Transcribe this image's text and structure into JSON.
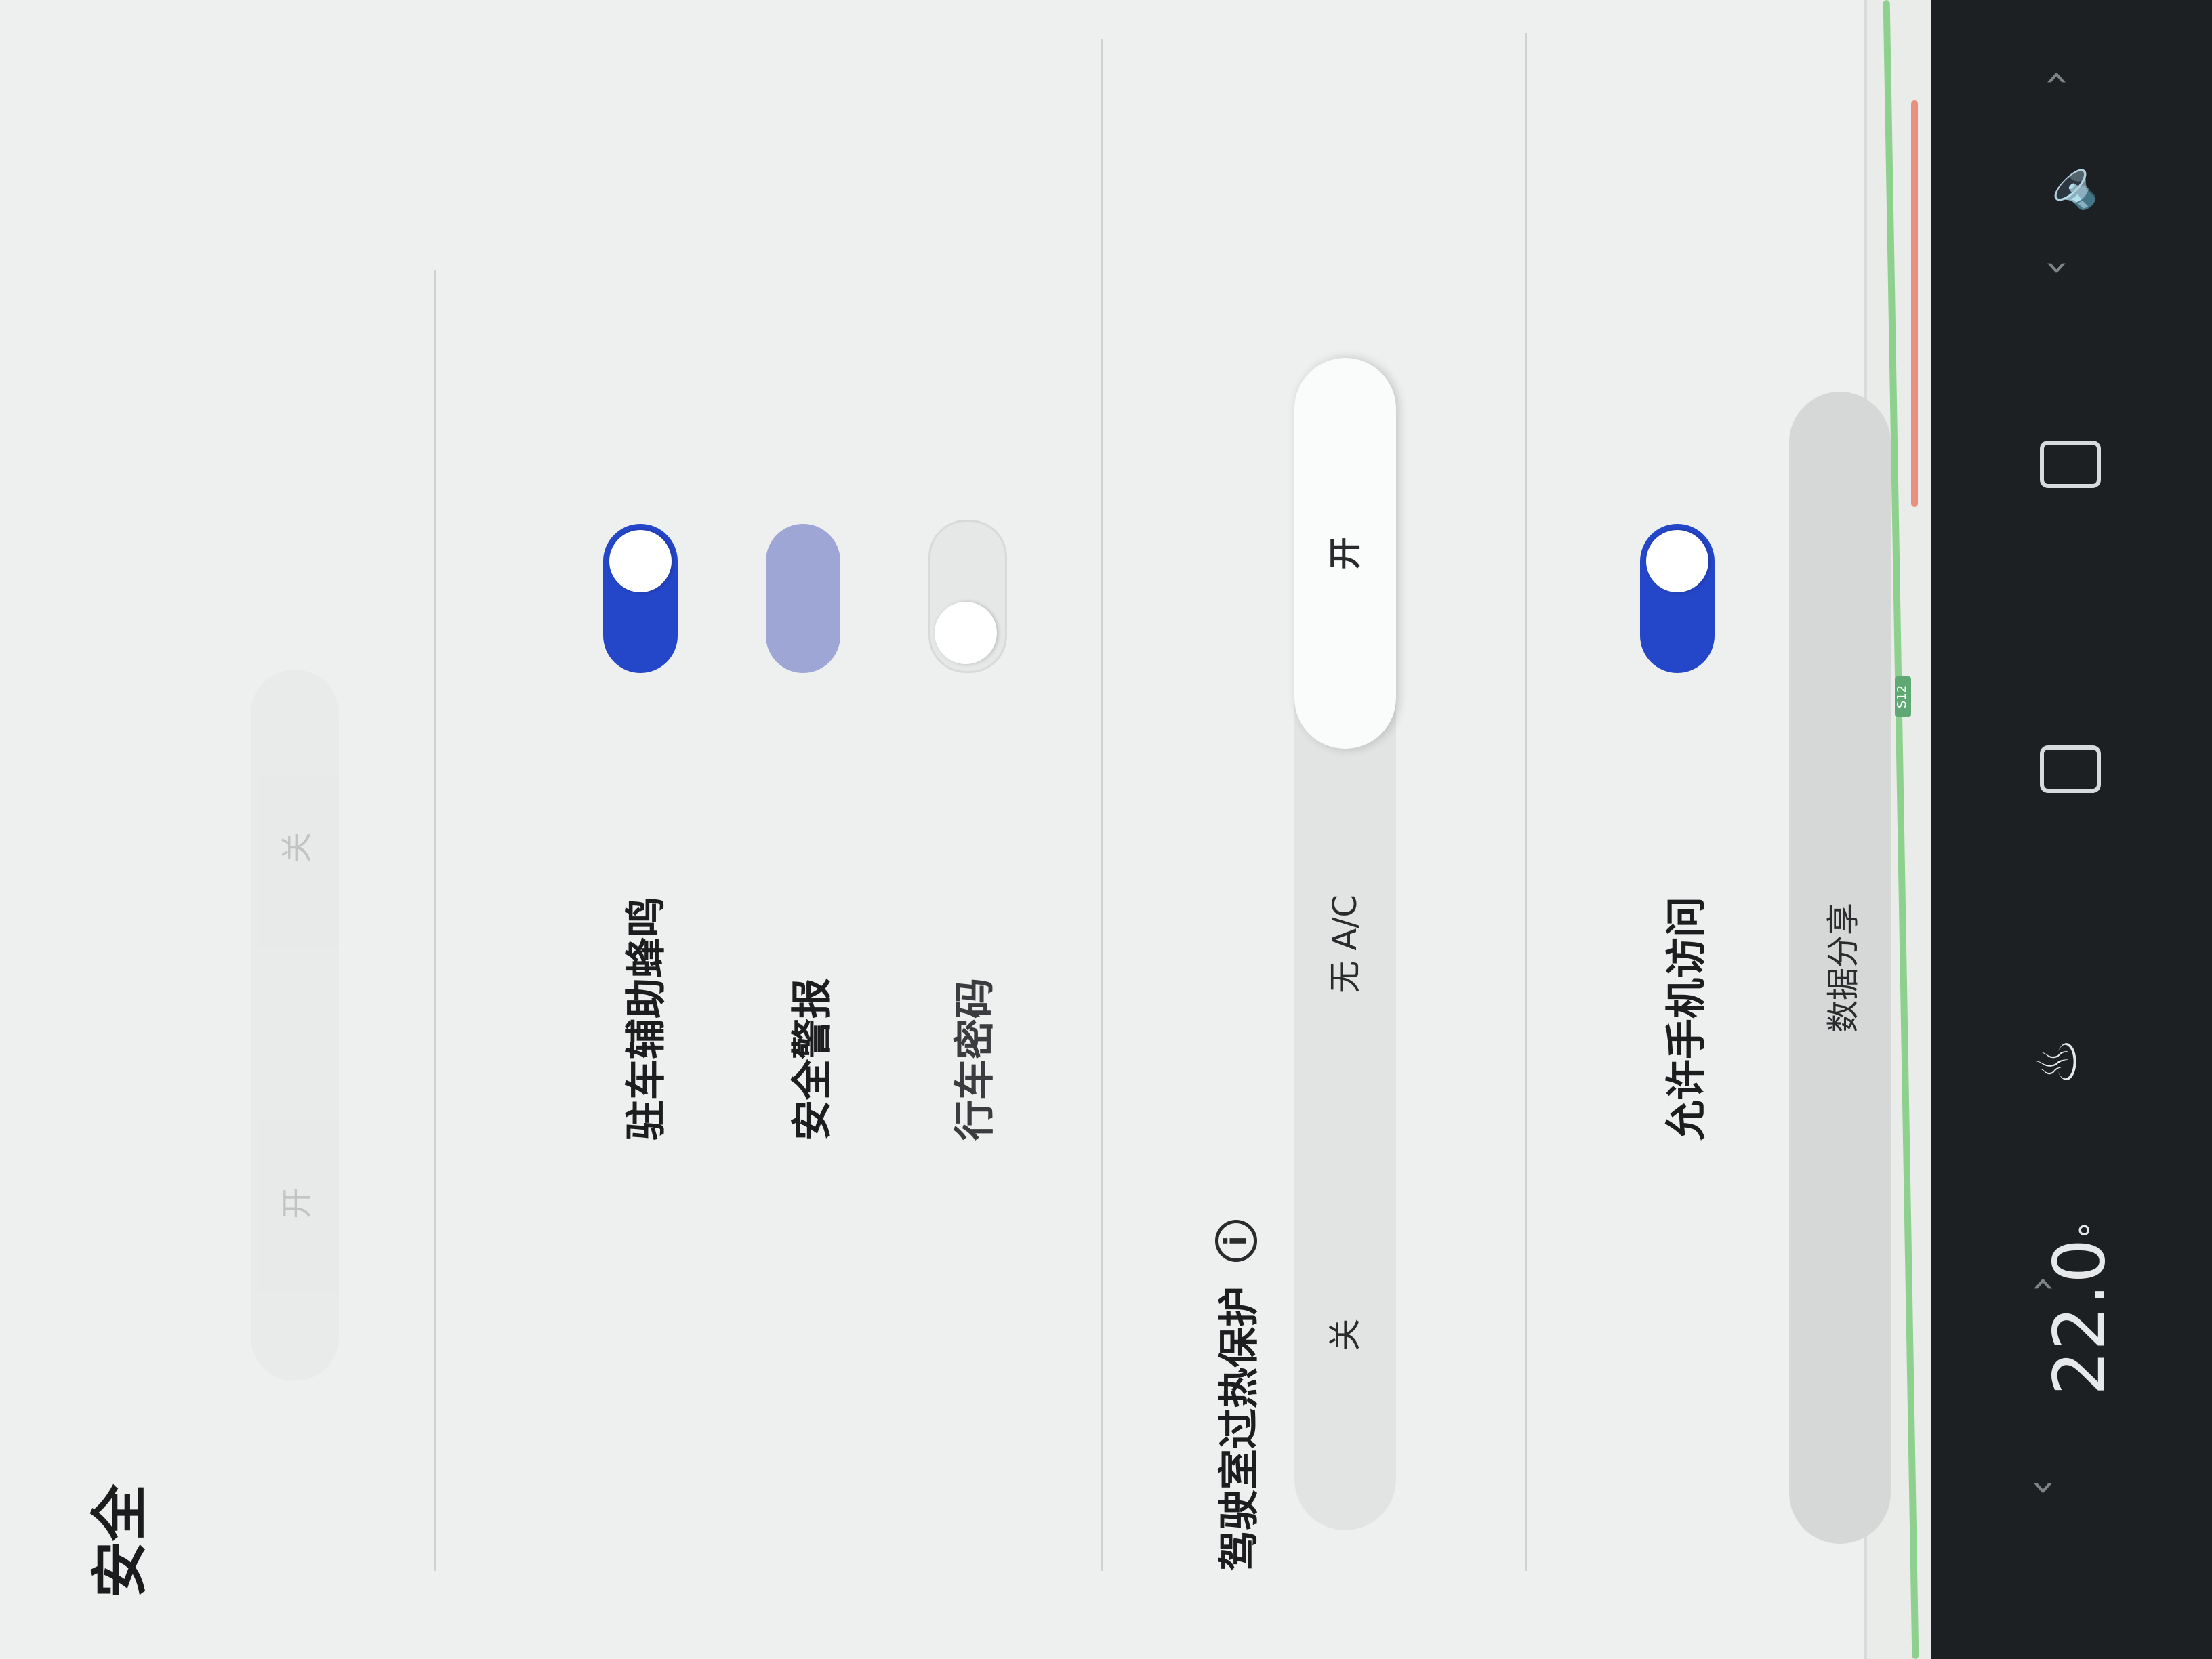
{
  "settings": {
    "title": "安全",
    "top_segment": {
      "options": [
        "开",
        "关"
      ]
    },
    "toggles": [
      {
        "label": "驻车辅助蜂鸣",
        "state": "on"
      },
      {
        "label": "安全警报",
        "state": "disabled"
      },
      {
        "label": "行车密码",
        "state": "off"
      }
    ],
    "overheat": {
      "label": "驾驶室过热保护",
      "info_icon": "i",
      "options": [
        "关",
        "无 A/C",
        "开"
      ],
      "selected": "开"
    },
    "phone_access": {
      "label": "允许手机访问",
      "state": "on"
    },
    "share_button": "数据分享"
  },
  "control_bar": {
    "temperature": "22.0",
    "temp_unit": "°",
    "left_chevron": "‹",
    "right_chevron": "›",
    "icons": [
      "seat-heat-icon",
      "rear-defrost-icon",
      "front-defrost-icon",
      "volume-icon"
    ]
  },
  "map": {
    "road_label": "S12"
  }
}
